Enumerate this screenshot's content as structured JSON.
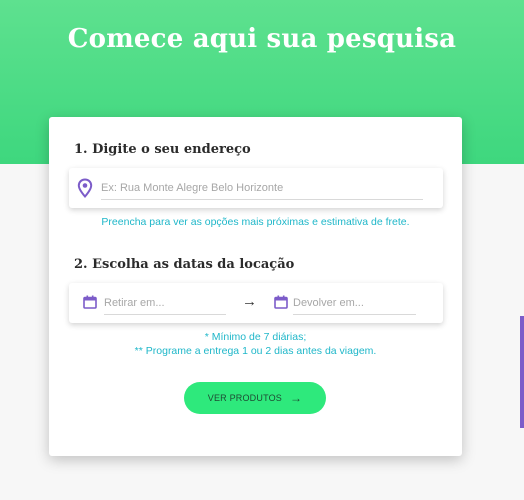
{
  "hero": {
    "title": "Comece aqui sua pesquisa"
  },
  "address_section": {
    "title": "1. Digite o seu endereço",
    "placeholder": "Ex: Rua Monte Alegre Belo Horizonte",
    "value": "",
    "helper": "Preencha para ver as opções mais próximas e estimativa de frete."
  },
  "dates_section": {
    "title": "2. Escolha as datas da locação",
    "pickup_placeholder": "Retirar em...",
    "return_placeholder": "Devolver em...",
    "arrow": "→",
    "note_1": "* Mínimo de 7 diárias;",
    "note_2": "** Programe a entrega 1 ou 2 dias antes da viagem."
  },
  "button": {
    "label": "VER PRODUTOS",
    "arrow": "→"
  },
  "colors": {
    "hero_green": "#3ed77e",
    "button_green": "#2ee97c",
    "helper_teal": "#1fb7c9",
    "icon_purple": "#7c5cc9"
  },
  "icons": {
    "address": "location-pin-icon",
    "pickup": "calendar-icon",
    "return": "calendar-icon"
  }
}
